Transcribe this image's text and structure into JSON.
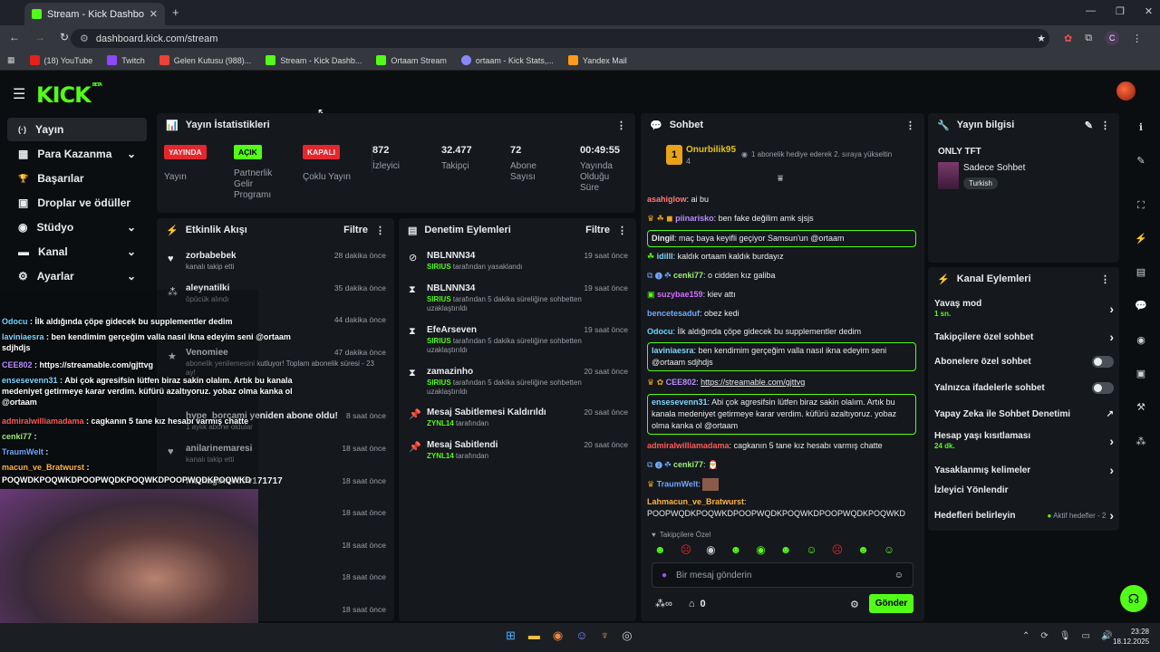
{
  "browser": {
    "tab_title": "Stream - Kick Dashboard",
    "url": "dashboard.kick.com/stream",
    "profile_initial": "C",
    "bookmarks": [
      "(18) YouTube",
      "Twitch",
      "Gelen Kutusu (988)...",
      "Stream - Kick Dashb...",
      "Ortaam Stream",
      "ortaam - Kick Stats,...",
      "Yandex Mail"
    ]
  },
  "app": {
    "logo": "KICK",
    "logo_badge": "BETA"
  },
  "sidebar": {
    "items": [
      {
        "label": "Yayın",
        "icon": "(·)"
      },
      {
        "label": "Para Kazanma",
        "icon": "▦"
      },
      {
        "label": "Başarılar",
        "icon": "🏆"
      },
      {
        "label": "Droplar ve ödüller",
        "icon": "▣"
      },
      {
        "label": "Stüdyo",
        "icon": "◉"
      },
      {
        "label": "Kanal",
        "icon": "▬"
      },
      {
        "label": "Ayarlar",
        "icon": "⚙"
      }
    ]
  },
  "stats": {
    "title": "Yayın İstatistikleri",
    "cells": [
      {
        "badge": "YAYINDA",
        "label": "Yayın"
      },
      {
        "badge": "AÇIK",
        "label": "Partnerlik Gelir Programı"
      },
      {
        "badge": "KAPALI",
        "label": "Çoklu Yayın"
      },
      {
        "value": "872",
        "label": "İzleyici"
      },
      {
        "value": "32.477",
        "label": "Takipçi"
      },
      {
        "value": "72",
        "label": "Abone Sayısı"
      },
      {
        "value": "00:49:55",
        "label": "Yayında Olduğu Süre"
      }
    ]
  },
  "activity": {
    "title": "Etkinlik Akışı",
    "filter": "Filtre",
    "rows": [
      {
        "name": "zorbabebek",
        "sub": "kanalı takip etti",
        "time": "28 dakika önce"
      },
      {
        "name": "aleynatilki",
        "sub": "öpücük alındı",
        "time": "35 dakika önce"
      },
      {
        "name": "",
        "sub": "",
        "time": "44 dakika önce"
      },
      {
        "name": "Venomiee",
        "sub": "abonelik yenilemesini kutluyor! Toplam abonelik süresi - 23 ay!",
        "time": "47 dakika önce"
      },
      {
        "name": "hype_borcami yeniden abone oldu!",
        "sub": "1 aylık abone oldular",
        "time": "8 saat önce"
      },
      {
        "name": "anilarinemaresi",
        "sub": "kanalı takip etti",
        "time": "18 saat önce"
      },
      {
        "name": "mamagomedov171717",
        "sub": "",
        "time": "18 saat önce"
      },
      {
        "name": "",
        "sub": "",
        "time": "18 saat önce"
      },
      {
        "name": "",
        "sub": "",
        "time": "18 saat önce"
      },
      {
        "name": "",
        "sub": "",
        "time": "18 saat önce"
      },
      {
        "name": "",
        "sub": "",
        "time": "18 saat önce"
      }
    ]
  },
  "moderation": {
    "title": "Denetim Eylemleri",
    "filter": "Filtre",
    "rows": [
      {
        "name": "NBLNNN34",
        "by": "SIRIUS",
        "sub": "tarafından yasaklandı",
        "time": "19 saat önce",
        "icon": "⊘"
      },
      {
        "name": "NBLNNN34",
        "by": "SIRIUS",
        "sub": "tarafından 5 dakika süreliğine sohbetten uzaklaştırıldı",
        "time": "19 saat önce",
        "icon": "⧗"
      },
      {
        "name": "EfeArseven",
        "by": "SIRIUS",
        "sub": "tarafından 5 dakika süreliğine sohbetten uzaklaştırıldı",
        "time": "19 saat önce",
        "icon": "⧗"
      },
      {
        "name": "zamazinho",
        "by": "SIRIUS",
        "sub": "tarafından 5 dakika süreliğine sohbetten uzaklaştırıldı",
        "time": "20 saat önce",
        "icon": "⧗"
      },
      {
        "name": "Mesaj Sabitlemesi Kaldırıldı",
        "by": "ZYNL14",
        "sub": "tarafından",
        "time": "20 saat önce",
        "icon": "📌"
      },
      {
        "name": "Mesaj Sabitlendi",
        "by": "ZYNL14",
        "sub": "tarafından",
        "time": "20 saat önce",
        "icon": "📌"
      }
    ]
  },
  "chat": {
    "title": "Sohbet",
    "top_gifter": {
      "rank": "1",
      "name": "Onurbilik95",
      "count": "4",
      "note": "1 abonelik hediye ederek 2. sıraya yükseltin"
    },
    "messages": [
      {
        "user": "asahiglow",
        "text": "ai bu",
        "color": "#ff7a7a"
      },
      {
        "user": "piinarisko",
        "text": "ben fake değilim amk sjsjs",
        "color": "#b98cff"
      },
      {
        "user": "Dingil",
        "text": "maç baya keyifli geçiyor Samsun'un @ortaam",
        "color": "#ffffff",
        "hl": true
      },
      {
        "user": "idilll",
        "text": "kaldık ortaam kaldık burdayız",
        "color": "#7fd4ff"
      },
      {
        "user": "cenki77",
        "text": "o cidden kız galiba",
        "color": "#9cf07a"
      },
      {
        "user": "suzybae159",
        "text": "kiev attı",
        "color": "#d36cff"
      },
      {
        "user": "bencetesaduf",
        "text": "obez kedi",
        "color": "#6fa8ff"
      },
      {
        "user": "Odocu",
        "text": "İlk aldığında çöpe gidecek bu supplementler dedim",
        "color": "#6ad7ff"
      },
      {
        "user": "laviniaesra",
        "text": "ben kendimim gerçeğim valla nasıl ikna edeyim seni @ortaam sdjhdjs",
        "color": "#7fd4ff",
        "hl": true
      },
      {
        "user": "CEE802",
        "text": "https://streamable.com/gjttvg",
        "color": "#b98cff"
      },
      {
        "user": "ensesevenn31",
        "text": "Abi çok agresifsin lütfen biraz sakin olalım. Artık bu kanala medeniyet getirmeye karar verdim. küfürü azaltıyoruz. yobaz olma kanka ol @ortaam",
        "color": "#7fd4ff",
        "hl": true
      },
      {
        "user": "admiralwilliamadama",
        "text": "cagkanın 5 tane kız hesabı varmış chatte",
        "color": "#ff5a5a"
      },
      {
        "user": "cenki77",
        "text": "",
        "color": "#9cf07a"
      },
      {
        "user": "TraumWelt",
        "text": "",
        "color": "#6fa8ff"
      },
      {
        "user": "Lahmacun_ve_Bratwurst",
        "text": "POOPWQDKPOQWKDPOOPWQDKPOQWKDPOOPWQDKPOQWKD",
        "color": "#ffb347"
      }
    ],
    "emote_label": "Takipçilere Özel",
    "input_placeholder": "Bir mesaj gönderin",
    "points": "0",
    "send": "Gönder"
  },
  "stream_info": {
    "title": "Yayın bilgisi",
    "stream_title": "ONLY TFT",
    "category": "Sadece Sohbet",
    "tag": "Turkish"
  },
  "channel_actions": {
    "title": "Kanal Eylemleri",
    "rows": [
      {
        "label": "Yavaş mod",
        "sub": "1 sn.",
        "ctl": "chevron"
      },
      {
        "label": "Takipçilere özel sohbet",
        "sub": "",
        "ctl": "chevron"
      },
      {
        "label": "Abonelere özel sohbet",
        "sub": "",
        "ctl": "toggle"
      },
      {
        "label": "Yalnızca ifadelerle sohbet",
        "sub": "",
        "ctl": "toggle"
      },
      {
        "label": "Yapay Zeka ile Sohbet Denetimi",
        "sub": "",
        "ctl": "external"
      },
      {
        "label": "Hesap yaşı kısıtlaması",
        "sub": "24 dk.",
        "ctl": "chevron"
      },
      {
        "label": "Yasaklanmış kelimeler",
        "sub": "",
        "ctl": "chevron"
      },
      {
        "label": "İzleyici Yönlendir",
        "sub": "",
        "ctl": "none"
      },
      {
        "label": "Hedefleri belirleyin",
        "sub": "",
        "ctl": "chevron",
        "extra": "Aktif hedefler - 2"
      }
    ]
  },
  "overlay_chat": [
    {
      "user": "Odocu",
      "text": "İlk aldığında çöpe gidecek bu supplementler dedim",
      "color": "#6ad7ff"
    },
    {
      "user": "laviniaesra",
      "text": "ben kendimim gerçeğim valla nasıl ikna edeyim seni @ortaam sdjhdjs",
      "color": "#7fd4ff"
    },
    {
      "user": "CEE802",
      "text": "https://streamable.com/gjttvg",
      "color": "#b98cff"
    },
    {
      "user": "ensesevenn31",
      "text": "Abi çok agresifsin lütfen biraz sakin olalım. Artık bu kanala medeniyet getirmeye karar verdim. küfürü azaltıyoruz. yobaz olma kanka ol @ortaam",
      "color": "#7fd4ff"
    },
    {
      "user": "admiralwilliamadama",
      "text": "cagkanın 5 tane kız hesabı varmış chatte",
      "color": "#ff5a5a"
    },
    {
      "user": "cenki77",
      "text": "",
      "color": "#9cf07a"
    },
    {
      "user": "TraumWelt",
      "text": "",
      "color": "#6fa8ff"
    },
    {
      "user": "macun_ve_Bratwurst",
      "text": "",
      "color": "#ffb347"
    },
    {
      "user": "",
      "text": "POQWDKPOQWKDPOOPWQDKPOQWKDPOOPWQDKPOQWKD",
      "color": "#ffffff"
    }
  ],
  "taskbar": {
    "time": "23:28",
    "date": "18.12.2025"
  },
  "colors": {
    "accent": "#53fc18",
    "live": "#e5262c",
    "bg": "#0b0e10",
    "panel": "#15181c"
  }
}
